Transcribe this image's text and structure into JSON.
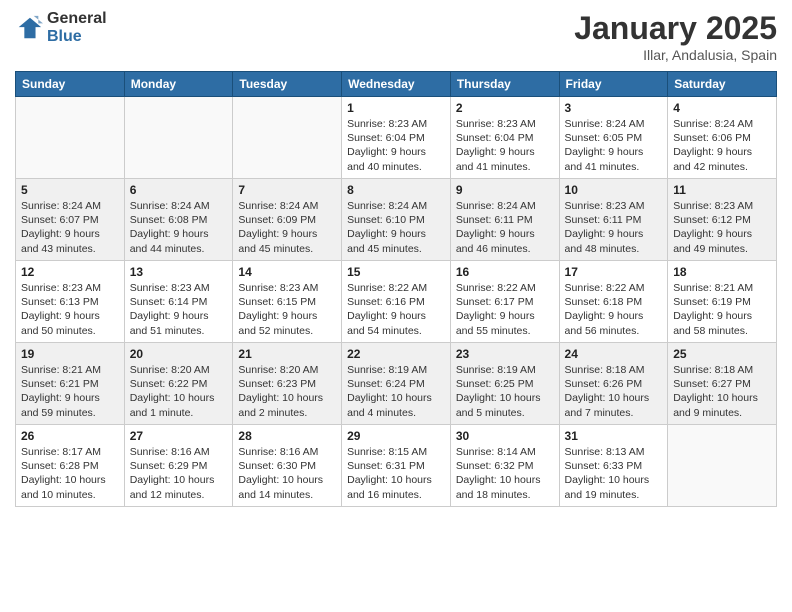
{
  "logo": {
    "general": "General",
    "blue": "Blue"
  },
  "title": "January 2025",
  "subtitle": "Illar, Andalusia, Spain",
  "weekdays": [
    "Sunday",
    "Monday",
    "Tuesday",
    "Wednesday",
    "Thursday",
    "Friday",
    "Saturday"
  ],
  "rows": [
    [
      {
        "day": "",
        "info": ""
      },
      {
        "day": "",
        "info": ""
      },
      {
        "day": "",
        "info": ""
      },
      {
        "day": "1",
        "info": "Sunrise: 8:23 AM\nSunset: 6:04 PM\nDaylight: 9 hours and 40 minutes."
      },
      {
        "day": "2",
        "info": "Sunrise: 8:23 AM\nSunset: 6:04 PM\nDaylight: 9 hours and 41 minutes."
      },
      {
        "day": "3",
        "info": "Sunrise: 8:24 AM\nSunset: 6:05 PM\nDaylight: 9 hours and 41 minutes."
      },
      {
        "day": "4",
        "info": "Sunrise: 8:24 AM\nSunset: 6:06 PM\nDaylight: 9 hours and 42 minutes."
      }
    ],
    [
      {
        "day": "5",
        "info": "Sunrise: 8:24 AM\nSunset: 6:07 PM\nDaylight: 9 hours and 43 minutes."
      },
      {
        "day": "6",
        "info": "Sunrise: 8:24 AM\nSunset: 6:08 PM\nDaylight: 9 hours and 44 minutes."
      },
      {
        "day": "7",
        "info": "Sunrise: 8:24 AM\nSunset: 6:09 PM\nDaylight: 9 hours and 45 minutes."
      },
      {
        "day": "8",
        "info": "Sunrise: 8:24 AM\nSunset: 6:10 PM\nDaylight: 9 hours and 45 minutes."
      },
      {
        "day": "9",
        "info": "Sunrise: 8:24 AM\nSunset: 6:11 PM\nDaylight: 9 hours and 46 minutes."
      },
      {
        "day": "10",
        "info": "Sunrise: 8:23 AM\nSunset: 6:11 PM\nDaylight: 9 hours and 48 minutes."
      },
      {
        "day": "11",
        "info": "Sunrise: 8:23 AM\nSunset: 6:12 PM\nDaylight: 9 hours and 49 minutes."
      }
    ],
    [
      {
        "day": "12",
        "info": "Sunrise: 8:23 AM\nSunset: 6:13 PM\nDaylight: 9 hours and 50 minutes."
      },
      {
        "day": "13",
        "info": "Sunrise: 8:23 AM\nSunset: 6:14 PM\nDaylight: 9 hours and 51 minutes."
      },
      {
        "day": "14",
        "info": "Sunrise: 8:23 AM\nSunset: 6:15 PM\nDaylight: 9 hours and 52 minutes."
      },
      {
        "day": "15",
        "info": "Sunrise: 8:22 AM\nSunset: 6:16 PM\nDaylight: 9 hours and 54 minutes."
      },
      {
        "day": "16",
        "info": "Sunrise: 8:22 AM\nSunset: 6:17 PM\nDaylight: 9 hours and 55 minutes."
      },
      {
        "day": "17",
        "info": "Sunrise: 8:22 AM\nSunset: 6:18 PM\nDaylight: 9 hours and 56 minutes."
      },
      {
        "day": "18",
        "info": "Sunrise: 8:21 AM\nSunset: 6:19 PM\nDaylight: 9 hours and 58 minutes."
      }
    ],
    [
      {
        "day": "19",
        "info": "Sunrise: 8:21 AM\nSunset: 6:21 PM\nDaylight: 9 hours and 59 minutes."
      },
      {
        "day": "20",
        "info": "Sunrise: 8:20 AM\nSunset: 6:22 PM\nDaylight: 10 hours and 1 minute."
      },
      {
        "day": "21",
        "info": "Sunrise: 8:20 AM\nSunset: 6:23 PM\nDaylight: 10 hours and 2 minutes."
      },
      {
        "day": "22",
        "info": "Sunrise: 8:19 AM\nSunset: 6:24 PM\nDaylight: 10 hours and 4 minutes."
      },
      {
        "day": "23",
        "info": "Sunrise: 8:19 AM\nSunset: 6:25 PM\nDaylight: 10 hours and 5 minutes."
      },
      {
        "day": "24",
        "info": "Sunrise: 8:18 AM\nSunset: 6:26 PM\nDaylight: 10 hours and 7 minutes."
      },
      {
        "day": "25",
        "info": "Sunrise: 8:18 AM\nSunset: 6:27 PM\nDaylight: 10 hours and 9 minutes."
      }
    ],
    [
      {
        "day": "26",
        "info": "Sunrise: 8:17 AM\nSunset: 6:28 PM\nDaylight: 10 hours and 10 minutes."
      },
      {
        "day": "27",
        "info": "Sunrise: 8:16 AM\nSunset: 6:29 PM\nDaylight: 10 hours and 12 minutes."
      },
      {
        "day": "28",
        "info": "Sunrise: 8:16 AM\nSunset: 6:30 PM\nDaylight: 10 hours and 14 minutes."
      },
      {
        "day": "29",
        "info": "Sunrise: 8:15 AM\nSunset: 6:31 PM\nDaylight: 10 hours and 16 minutes."
      },
      {
        "day": "30",
        "info": "Sunrise: 8:14 AM\nSunset: 6:32 PM\nDaylight: 10 hours and 18 minutes."
      },
      {
        "day": "31",
        "info": "Sunrise: 8:13 AM\nSunset: 6:33 PM\nDaylight: 10 hours and 19 minutes."
      },
      {
        "day": "",
        "info": ""
      }
    ]
  ]
}
